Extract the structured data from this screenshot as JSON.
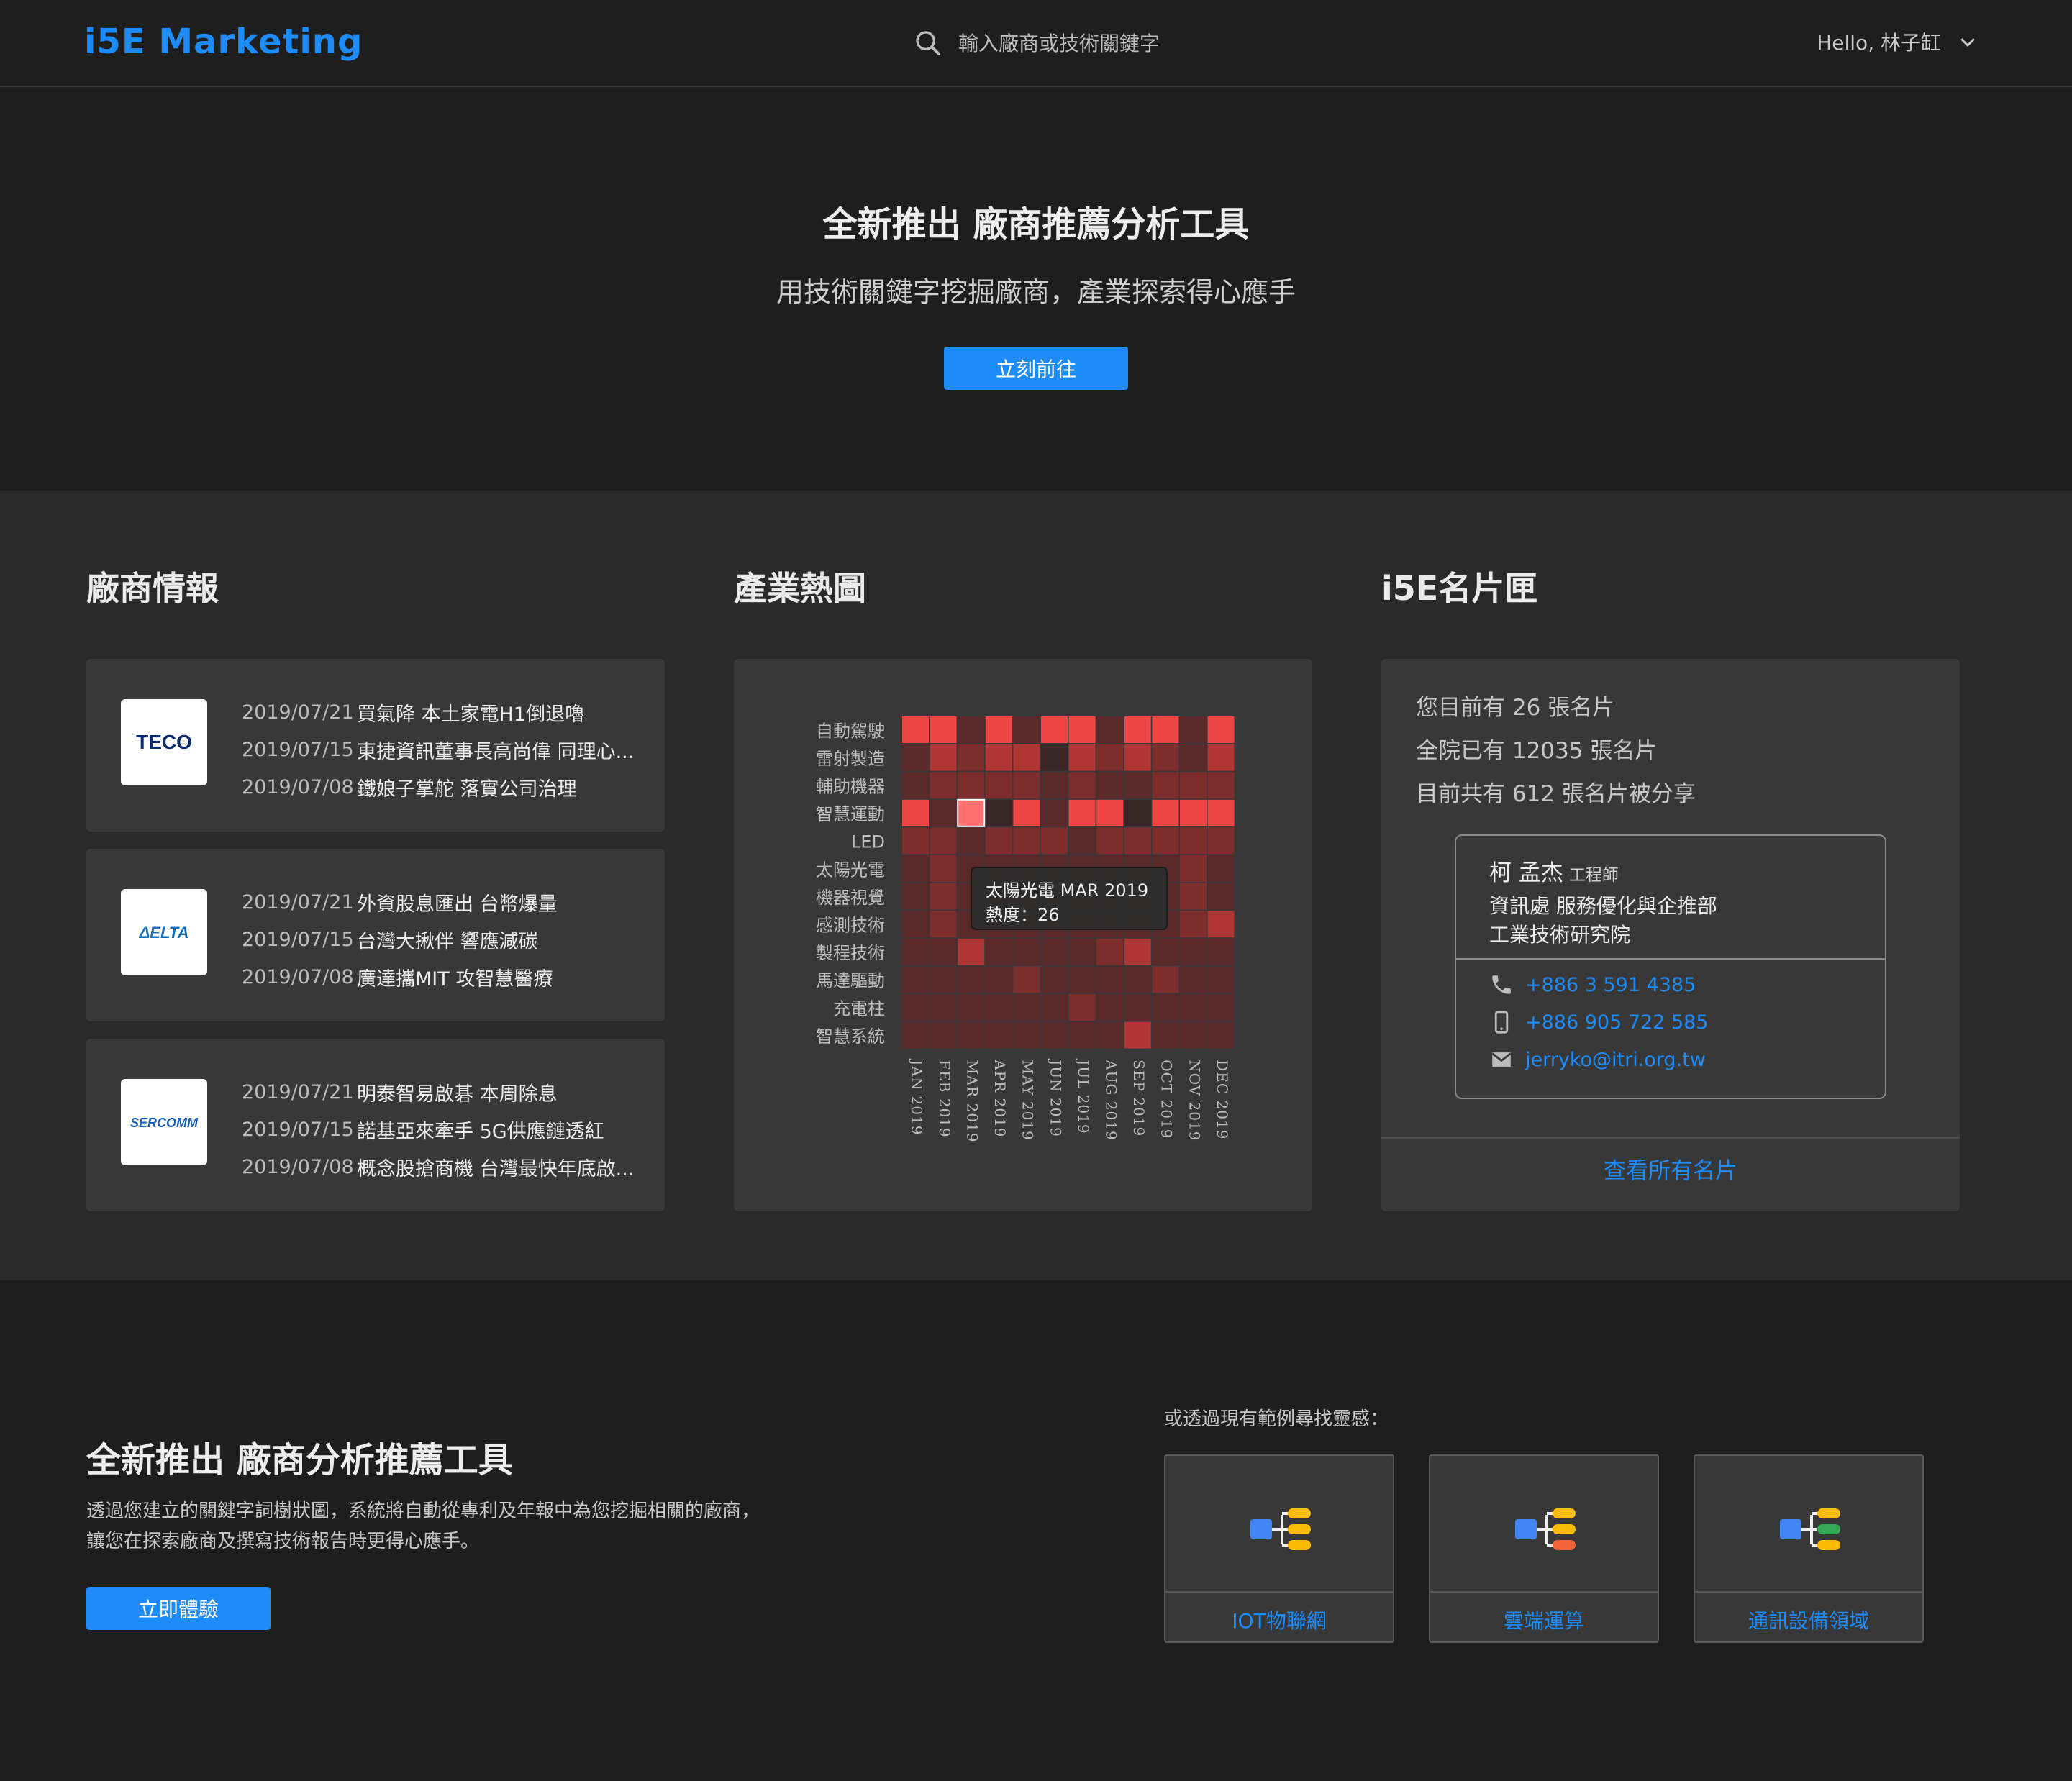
{
  "header": {
    "logo": "i5E Marketing",
    "search_placeholder": "輸入廠商或技術關鍵字",
    "greeting": "Hello, 林子缸"
  },
  "hero": {
    "title": "全新推出 廠商推薦分析工具",
    "subtitle": "用技術關鍵字挖掘廠商，產業探索得心應手",
    "button": "立刻前往"
  },
  "company_news": {
    "title": "廠商情報",
    "companies": [
      {
        "logo": "TECO",
        "brand_color": "#0a2a6e",
        "items": [
          {
            "date": "2019/07/21",
            "title": "買氣降 本土家電H1倒退嚕"
          },
          {
            "date": "2019/07/15",
            "title": "東捷資訊董事長高尚偉 同理心..."
          },
          {
            "date": "2019/07/08",
            "title": "鐵娘子掌舵 落實公司治理"
          }
        ]
      },
      {
        "logo": "ΔELTA",
        "brand_color": "#1a6fb5",
        "items": [
          {
            "date": "2019/07/21",
            "title": "外資股息匯出 台幣爆量"
          },
          {
            "date": "2019/07/15",
            "title": "台灣大揪伴 響應減碳"
          },
          {
            "date": "2019/07/08",
            "title": "廣達攜MIT 攻智慧醫療"
          }
        ]
      },
      {
        "logo": "SERCOMM",
        "brand_color": "#1a5fb0",
        "items": [
          {
            "date": "2019/07/21",
            "title": "明泰智易啟碁 本周除息"
          },
          {
            "date": "2019/07/15",
            "title": "諾基亞來牽手 5G供應鏈透紅"
          },
          {
            "date": "2019/07/08",
            "title": "概念股搶商機 台灣最快年底啟..."
          }
        ]
      }
    ]
  },
  "heatmap": {
    "title": "產業熱圖",
    "chart_data": {
      "type": "heatmap",
      "rows": [
        "自動駕駛",
        "雷射製造",
        "輔助機器",
        "智慧運動",
        "LED",
        "太陽光電",
        "機器視覺",
        "感測技術",
        "製程技術",
        "馬達驅動",
        "充電柱",
        "智慧系統"
      ],
      "columns": [
        "JAN 2019",
        "FEB 2019",
        "MAR 2019",
        "APR 2019",
        "MAY 2019",
        "JUN 2019",
        "JUL 2019",
        "AUG 2019",
        "SEP 2019",
        "OCT 2019",
        "NOV 2019",
        "DEC 2019"
      ],
      "levels": [
        [
          4,
          4,
          1,
          4,
          1,
          4,
          4,
          1,
          4,
          4,
          1,
          4
        ],
        [
          1,
          3,
          2,
          3,
          3,
          0,
          3,
          2,
          3,
          2,
          1,
          3
        ],
        [
          1,
          2,
          2,
          2,
          2,
          1,
          2,
          1,
          1,
          2,
          2,
          2
        ],
        [
          4,
          1,
          5,
          0,
          4,
          1,
          4,
          4,
          0,
          4,
          4,
          4
        ],
        [
          2,
          2,
          1,
          2,
          2,
          2,
          1,
          2,
          2,
          2,
          2,
          2
        ],
        [
          1,
          2,
          1,
          1,
          1,
          1,
          1,
          1,
          1,
          1,
          2,
          1
        ],
        [
          1,
          2,
          1,
          1,
          1,
          1,
          1,
          1,
          1,
          1,
          2,
          1
        ],
        [
          1,
          2,
          1,
          1,
          1,
          1,
          1,
          1,
          1,
          1,
          2,
          3
        ],
        [
          1,
          1,
          3,
          1,
          1,
          1,
          1,
          2,
          3,
          1,
          1,
          1
        ],
        [
          1,
          1,
          1,
          1,
          2,
          1,
          1,
          1,
          1,
          2,
          1,
          1
        ],
        [
          1,
          1,
          1,
          1,
          1,
          1,
          2,
          1,
          1,
          1,
          1,
          1
        ],
        [
          1,
          1,
          1,
          1,
          1,
          1,
          1,
          1,
          3,
          1,
          1,
          1
        ]
      ],
      "level_colors": [
        "#3a2626",
        "#5a2a2a",
        "#7e2d2d",
        "#b03636",
        "#f04545",
        "#ff7070"
      ],
      "tooltip": {
        "line1": "太陽光電 MAR 2019",
        "line2": "熱度：26"
      }
    }
  },
  "card_holder": {
    "title": "i5E名片匣",
    "stats": [
      "您目前有 26 張名片",
      "全院已有 12035 張名片",
      "目前共有 612 張名片被分享"
    ],
    "card": {
      "name": "柯 孟杰",
      "job_title": "工程師",
      "department": "資訊處 服務優化與企推部",
      "organization": "工業技術研究院",
      "phone": "+886 3 591 4385",
      "mobile": "+886 905 722 585",
      "email": "jerryko@itri.org.tw"
    },
    "view_all": "查看所有名片"
  },
  "bottom": {
    "title": "全新推出 廠商分析推薦工具",
    "description_line1": "透過您建立的關鍵字詞樹狀圖，系統將自動從專利及年報中為您挖掘相關的廠商，",
    "description_line2": "讓您在探索廠商及撰寫技術報告時更得心應手。",
    "button": "立即體驗",
    "examples_label": "或透過現有範例尋找靈感：",
    "examples": [
      {
        "name": "IOT物聯網",
        "icon_colors": [
          "#4285f4",
          "#fbbc05",
          "#fbbc05",
          "#fbbc05"
        ]
      },
      {
        "name": "雲端運算",
        "icon_colors": [
          "#4285f4",
          "#fbbc05",
          "#fbbc05",
          "#f4623a"
        ]
      },
      {
        "name": "通訊設備領域",
        "icon_colors": [
          "#4285f4",
          "#fbbc05",
          "#34a853",
          "#fbbc05"
        ]
      }
    ]
  }
}
